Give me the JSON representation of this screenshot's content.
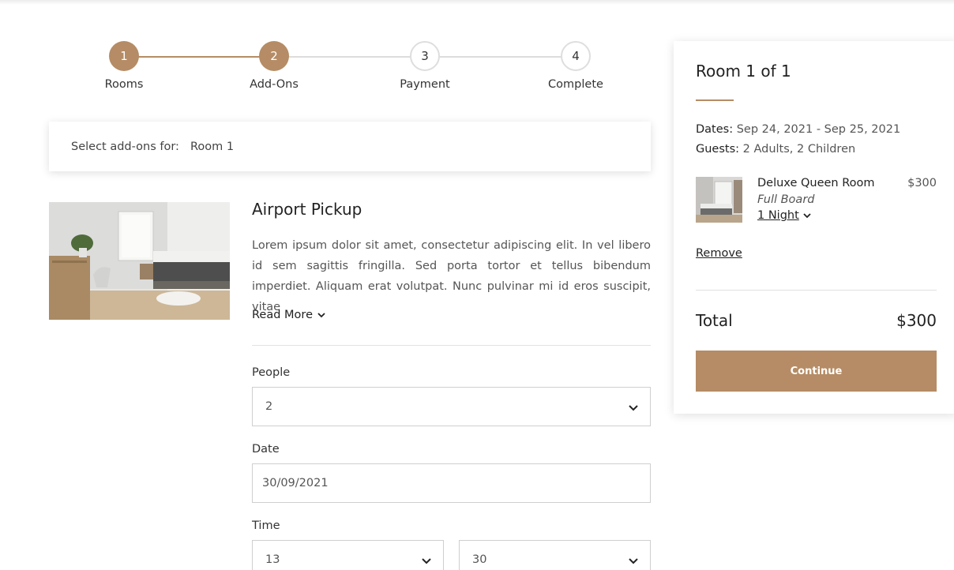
{
  "steps": [
    {
      "number": "1",
      "label": "Rooms",
      "state": "done"
    },
    {
      "number": "2",
      "label": "Add-Ons",
      "state": "done"
    },
    {
      "number": "3",
      "label": "Payment",
      "state": "todo"
    },
    {
      "number": "4",
      "label": "Complete",
      "state": "todo"
    }
  ],
  "selector": {
    "label": "Select add-ons for:",
    "value": "Room 1"
  },
  "addon": {
    "title": "Airport Pickup",
    "description": "Lorem ipsum dolor sit amet, consectetur adipiscing elit. In vel libero id sem sagittis fringilla. Sed porta tortor et tellus bibendum imperdiet. Aliquam erat volutpat. Nunc pulvinar mi id eros suscipit, vitae",
    "read_more": "Read More"
  },
  "form": {
    "people_label": "People",
    "people_value": "2",
    "date_label": "Date",
    "date_value": "30/09/2021",
    "time_label": "Time",
    "time_hour": "13",
    "time_minute": "30"
  },
  "summary": {
    "title": "Room 1 of 1",
    "dates_label": "Dates:",
    "dates_value": "Sep 24, 2021 - Sep 25, 2021",
    "guests_label": "Guests:",
    "guests_value": "2 Adults, 2 Children",
    "room_name": "Deluxe Queen Room",
    "board": "Full Board",
    "nights": "1 Night",
    "room_price": "$300",
    "remove": "Remove",
    "total_label": "Total",
    "total_value": "$300",
    "continue": "Continue"
  },
  "colors": {
    "accent": "#b58c65",
    "border": "#cfcfcf"
  }
}
